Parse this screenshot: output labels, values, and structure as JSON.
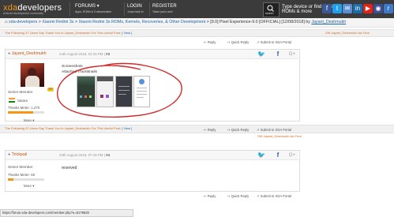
{
  "header": {
    "logo_main": "xda",
    "logo_rest": "developers",
    "logo_tagline": "Android development community",
    "forums_label": "FORUMS",
    "forums_sub": "Apps, ROMs & Customization",
    "login_label": "LOGIN",
    "login_sub": "Jump back in",
    "register_label": "REGISTER",
    "register_sub": "Takes just a sec!",
    "search_button_label": "search",
    "search_hint": "Type device or find apps, ROMs & more",
    "social_icons": [
      {
        "name": "facebook-icon",
        "color": "#3b5998",
        "glyph": "f"
      },
      {
        "name": "twitter-icon",
        "color": "#1da1f2",
        "glyph": "t"
      },
      {
        "name": "email-icon",
        "color": "#5a8fd6",
        "glyph": "✉"
      },
      {
        "name": "linkedin-icon",
        "color": "#1a6da8",
        "glyph": "in"
      },
      {
        "name": "youtube-icon",
        "color": "#e62117",
        "glyph": "▶"
      },
      {
        "name": "rss-icon",
        "color": "#3d4e92",
        "glyph": "◉"
      },
      {
        "name": "reddit-icon",
        "color": "#3d7ac9",
        "glyph": "r"
      }
    ]
  },
  "breadcrumb": {
    "items": [
      "xda-developers",
      "Xiaomi Redmi 3s",
      "Xiaomi Redmi 3s ROMs, Kernels, Recoveries, & Other Development"
    ],
    "thread_title": "[9.0] Pixel Experience-9.0 [OFFICIAL] [12/08/2018] by ",
    "thread_author": "Jayant_Deshmukh"
  },
  "thanks_row_top": {
    "text": "The Following 37 Users Say Thank You to Jayant_Deshmukh For This Useful Post:",
    "view": "[ View ]",
    "right": "Gift Jayant_Deshmukh Ad-Free"
  },
  "actions_top": {
    "reply": "Reply",
    "quick_reply": "Quick Reply",
    "submit": "Submit to XDA Portal"
  },
  "post1": {
    "username": "Jayant_Deshmukh",
    "date": "24th August 2018, 04:33 PM",
    "number": "#3",
    "op_badge": "OP",
    "role": "Senior Member",
    "location": "Satara",
    "thanks_meter": "Thanks Meter: 1,270",
    "rep_fraction": 0.7,
    "more": "More",
    "body_heading": "Screenshots",
    "attached": "Attached Thumbnails"
  },
  "thanks_row_mid": {
    "text": "The Following 22 Users Say Thank You to Jayant_Deshmukh For This Useful Post:",
    "view": "[ View ]",
    "right": "Gift Jayant_Deshmukh Ad-Free"
  },
  "actions_mid": {
    "reply": "Reply",
    "quick_reply": "Quick Reply",
    "submit": "Submit to XDA Portal"
  },
  "post2": {
    "username": "Trickpaii",
    "date": "24th August 2018, 07:43 PM",
    "number": "#4",
    "role": "Senior Member",
    "thanks_meter": "Thanks Meter: 60",
    "rep_fraction": 0.15,
    "more": "More",
    "body": "reserved"
  },
  "actions_bottom": {
    "reply": "Reply",
    "quick_reply": "Quick Reply",
    "submit": "Submit to XDA Portal"
  },
  "status_url": "https://forum.xda-developers.com/member.php?u=8179820",
  "colors": {
    "accent": "#f59714",
    "topbar": "#3b3b3b",
    "link": "#1f63a4",
    "annotation": "#d22a2a"
  }
}
